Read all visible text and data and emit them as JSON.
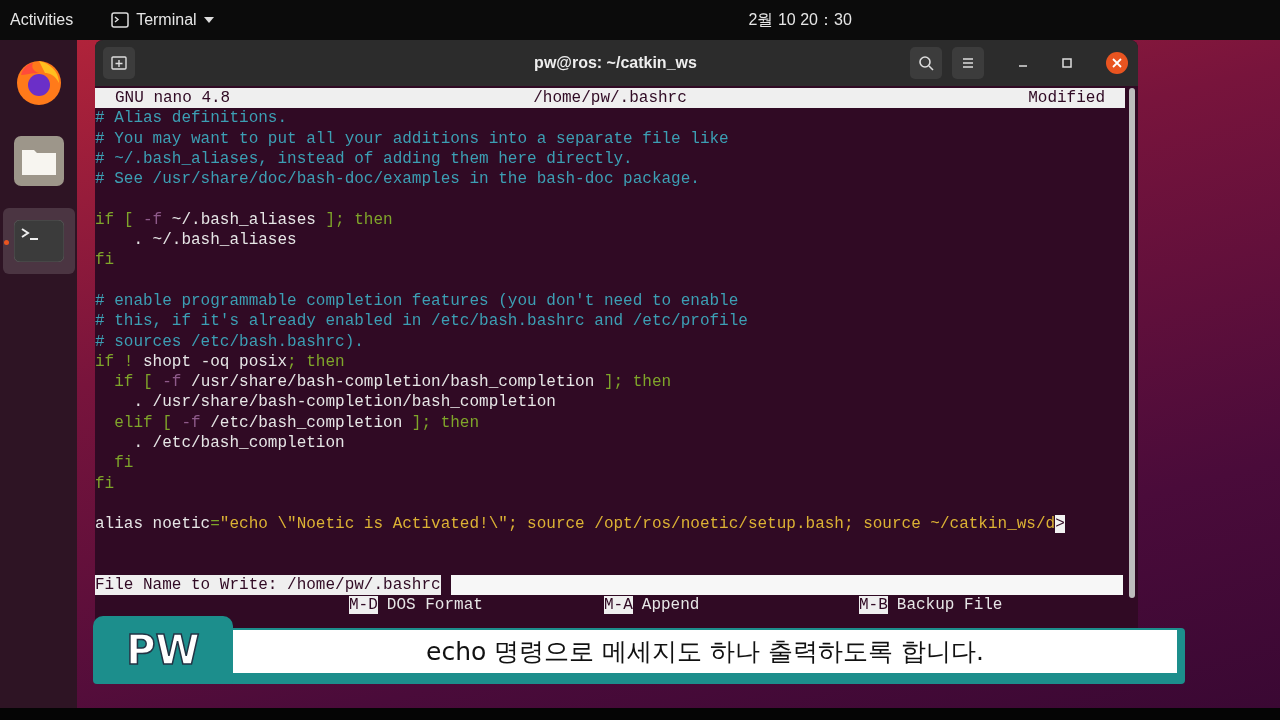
{
  "top_bar": {
    "activities": "Activities",
    "app_menu": "Terminal",
    "clock": "2월 10 20：30"
  },
  "dock": [
    {
      "kind": "firefox",
      "active": false
    },
    {
      "kind": "files",
      "active": false
    },
    {
      "kind": "terminal",
      "active": true
    }
  ],
  "window": {
    "title": "pw@ros: ~/catkin_ws"
  },
  "nano": {
    "header": {
      "version": "GNU nano 4.8",
      "file": "/home/pw/.bashrc",
      "status": "Modified"
    },
    "lines": [
      {
        "kind": "code",
        "segments": [
          {
            "kind": "comment",
            "text": "# Alias definitions."
          }
        ]
      },
      {
        "kind": "code",
        "segments": [
          {
            "kind": "comment",
            "text": "# You may want to put all your additions into a separate file like"
          }
        ]
      },
      {
        "kind": "code",
        "segments": [
          {
            "kind": "comment",
            "text": "# ~/.bash_aliases, instead of adding them here directly."
          }
        ]
      },
      {
        "kind": "code",
        "segments": [
          {
            "kind": "comment",
            "text": "# See /usr/share/doc/bash-doc/examples in the bash-doc package."
          }
        ]
      },
      {
        "kind": "blank"
      },
      {
        "kind": "code",
        "segments": [
          {
            "kind": "keyword",
            "text": "if [ "
          },
          {
            "kind": "option",
            "text": "-f"
          },
          {
            "kind": "plain",
            "text": " ~/.bash_aliases "
          },
          {
            "kind": "keyword",
            "text": "]; then"
          }
        ]
      },
      {
        "kind": "code",
        "segments": [
          {
            "kind": "plain",
            "text": "    . ~/.bash_aliases"
          }
        ]
      },
      {
        "kind": "code",
        "segments": [
          {
            "kind": "keyword",
            "text": "fi"
          }
        ]
      },
      {
        "kind": "blank"
      },
      {
        "kind": "code",
        "segments": [
          {
            "kind": "comment",
            "text": "# enable programmable completion features (you don't need to enable"
          }
        ]
      },
      {
        "kind": "code",
        "segments": [
          {
            "kind": "comment",
            "text": "# this, if it's already enabled in /etc/bash.bashrc and /etc/profile"
          }
        ]
      },
      {
        "kind": "code",
        "segments": [
          {
            "kind": "comment",
            "text": "# sources /etc/bash.bashrc)."
          }
        ]
      },
      {
        "kind": "code",
        "segments": [
          {
            "kind": "keyword",
            "text": "if ! "
          },
          {
            "kind": "plain",
            "text": "shopt -oq posix"
          },
          {
            "kind": "keyword",
            "text": "; then"
          }
        ]
      },
      {
        "kind": "code",
        "segments": [
          {
            "kind": "keyword",
            "text": "  if [ "
          },
          {
            "kind": "option",
            "text": "-f"
          },
          {
            "kind": "plain",
            "text": " /usr/share/bash-completion/bash_completion "
          },
          {
            "kind": "keyword",
            "text": "]; then"
          }
        ]
      },
      {
        "kind": "code",
        "segments": [
          {
            "kind": "plain",
            "text": "    . /usr/share/bash-completion/bash_completion"
          }
        ]
      },
      {
        "kind": "code",
        "segments": [
          {
            "kind": "keyword",
            "text": "  elif [ "
          },
          {
            "kind": "option",
            "text": "-f"
          },
          {
            "kind": "plain",
            "text": " /etc/bash_completion "
          },
          {
            "kind": "keyword",
            "text": "]; then"
          }
        ]
      },
      {
        "kind": "code",
        "segments": [
          {
            "kind": "plain",
            "text": "    . /etc/bash_completion"
          }
        ]
      },
      {
        "kind": "code",
        "segments": [
          {
            "kind": "keyword",
            "text": "  fi"
          }
        ]
      },
      {
        "kind": "code",
        "segments": [
          {
            "kind": "keyword",
            "text": "fi"
          }
        ]
      },
      {
        "kind": "blank"
      },
      {
        "kind": "code",
        "segments": [
          {
            "kind": "plain",
            "text": "alias noetic"
          },
          {
            "kind": "keyword",
            "text": "="
          },
          {
            "kind": "string",
            "text": "\"echo \\\"Noetic is Activated!\\\"; source /opt/ros/noetic/setup.bash; source ~/catkin_ws/d"
          },
          {
            "kind": "overflow",
            "text": ">"
          }
        ]
      },
      {
        "kind": "blank"
      },
      {
        "kind": "blank"
      }
    ],
    "prompt": {
      "label": "File Name to Write: /home/pw/.bashrc"
    },
    "shortcuts": [
      {
        "key": "M-D",
        "label": "DOS Format"
      },
      {
        "key": "M-A",
        "label": "Append"
      },
      {
        "key": "M-B",
        "label": "Backup File"
      }
    ]
  },
  "caption": {
    "tag": "PW",
    "text": "echo 명령으로 메세지도 하나 출력하도록 합니다."
  }
}
